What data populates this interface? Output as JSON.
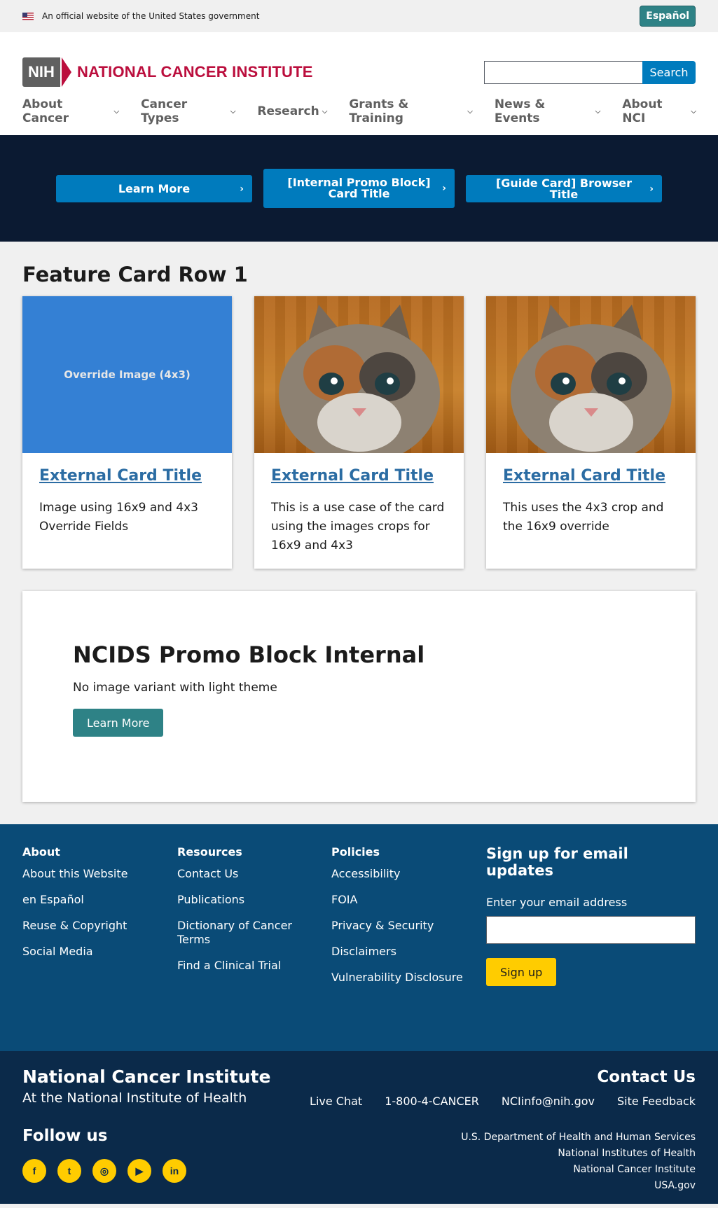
{
  "gov_banner": {
    "text": "An official website of the United States government",
    "espanol": "Español"
  },
  "header": {
    "logo_mark": "NIH",
    "logo_text": "NATIONAL CANCER INSTITUTE",
    "search_placeholder": "",
    "search_button": "Search",
    "nav": [
      {
        "label": "About Cancer"
      },
      {
        "label": "Cancer Types"
      },
      {
        "label": "Research"
      },
      {
        "label": "Grants & Training"
      },
      {
        "label": "News & Events"
      },
      {
        "label": "About NCI"
      }
    ]
  },
  "hero": {
    "cards": [
      {
        "label": "Learn More"
      },
      {
        "label": "[Internal Promo Block] Card Title"
      },
      {
        "label": "[Guide Card] Browser Title"
      }
    ]
  },
  "feature_row": {
    "title": "Feature Card Row 1",
    "cards": [
      {
        "image_text": "Override Image (4x3)",
        "title": "External Card Title",
        "desc": "Image using 16x9 and 4x3 Override Fields"
      },
      {
        "image_text": "",
        "title": "External Card Title",
        "desc": "This is a use case of the card using the images crops for 16x9 and 4x3"
      },
      {
        "image_text": "",
        "title": "External Card Title",
        "desc": "This uses the 4x3 crop and the 16x9 override"
      }
    ]
  },
  "promo": {
    "title": "NCIDS Promo Block Internal",
    "subtitle": "No image variant with light theme",
    "button": "Learn More"
  },
  "footer": {
    "columns": [
      {
        "heading": "About",
        "links": [
          "About this Website",
          "en Español",
          "Reuse & Copyright",
          "Social Media"
        ]
      },
      {
        "heading": "Resources",
        "links": [
          "Contact Us",
          "Publications",
          "Dictionary of Cancer Terms",
          "Find a Clinical Trial"
        ]
      },
      {
        "heading": "Policies",
        "links": [
          "Accessibility",
          "FOIA",
          "Privacy & Security",
          "Disclaimers",
          "Vulnerability Disclosure"
        ]
      }
    ],
    "signup": {
      "title": "Sign up for email updates",
      "label": "Enter your email address",
      "button": "Sign up"
    },
    "bottom": {
      "title": "National Cancer Institute",
      "subtitle": "At the National Institute of Health",
      "follow": "Follow us",
      "socials": [
        "facebook-icon",
        "twitter-icon",
        "instagram-icon",
        "youtube-icon",
        "linkedin-icon"
      ],
      "contact_title": "Contact Us",
      "contact_links": [
        "Live Chat",
        "1-800-4-CANCER",
        "NCIinfo@nih.gov",
        "Site Feedback"
      ],
      "agencies": [
        "U.S. Department of Health and Human Services",
        "National Institutes of Health",
        "National Cancer Institute",
        "USA.gov"
      ]
    }
  },
  "colors": {
    "brand_red": "#bb0e3d",
    "primary_blue": "#007bbd",
    "teal": "#2e8286",
    "footer_blue": "#0a4b77",
    "footer_dark": "#0b2a4a",
    "hero_navy": "#0b1a32",
    "accent_yellow": "#ffcc00"
  }
}
